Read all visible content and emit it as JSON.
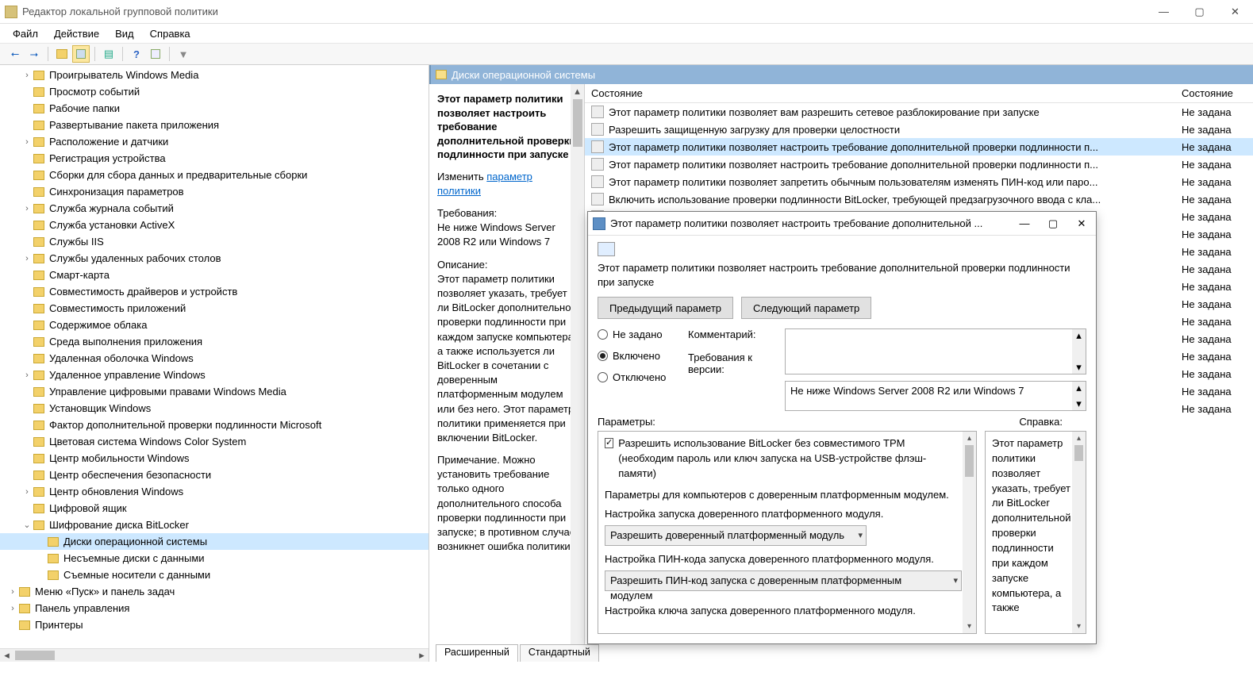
{
  "window": {
    "title": "Редактор локальной групповой политики"
  },
  "menu": {
    "file": "Файл",
    "action": "Действие",
    "view": "Вид",
    "help": "Справка"
  },
  "tree": [
    {
      "label": "Проигрыватель Windows Media",
      "exp": ">",
      "lvl": 1
    },
    {
      "label": "Просмотр событий",
      "exp": "",
      "lvl": 1
    },
    {
      "label": "Рабочие папки",
      "exp": "",
      "lvl": 1
    },
    {
      "label": "Развертывание пакета приложения",
      "exp": "",
      "lvl": 1
    },
    {
      "label": "Расположение и датчики",
      "exp": ">",
      "lvl": 1
    },
    {
      "label": "Регистрация устройства",
      "exp": "",
      "lvl": 1
    },
    {
      "label": "Сборки для сбора данных и предварительные сборки",
      "exp": "",
      "lvl": 1
    },
    {
      "label": "Синхронизация параметров",
      "exp": "",
      "lvl": 1
    },
    {
      "label": "Служба журнала событий",
      "exp": ">",
      "lvl": 1
    },
    {
      "label": "Служба установки ActiveX",
      "exp": "",
      "lvl": 1
    },
    {
      "label": "Службы IIS",
      "exp": "",
      "lvl": 1
    },
    {
      "label": "Службы удаленных рабочих столов",
      "exp": ">",
      "lvl": 1
    },
    {
      "label": "Смарт-карта",
      "exp": "",
      "lvl": 1
    },
    {
      "label": "Совместимость драйверов и устройств",
      "exp": "",
      "lvl": 1
    },
    {
      "label": "Совместимость приложений",
      "exp": "",
      "lvl": 1
    },
    {
      "label": "Содержимое облака",
      "exp": "",
      "lvl": 1
    },
    {
      "label": "Среда выполнения приложения",
      "exp": "",
      "lvl": 1
    },
    {
      "label": "Удаленная оболочка Windows",
      "exp": "",
      "lvl": 1
    },
    {
      "label": "Удаленное управление Windows",
      "exp": ">",
      "lvl": 1
    },
    {
      "label": "Управление цифровыми правами Windows Media",
      "exp": "",
      "lvl": 1
    },
    {
      "label": "Установщик Windows",
      "exp": "",
      "lvl": 1
    },
    {
      "label": "Фактор дополнительной проверки подлинности Microsoft",
      "exp": "",
      "lvl": 1
    },
    {
      "label": "Цветовая система Windows Color System",
      "exp": "",
      "lvl": 1
    },
    {
      "label": "Центр мобильности Windows",
      "exp": "",
      "lvl": 1
    },
    {
      "label": "Центр обеспечения безопасности",
      "exp": "",
      "lvl": 1
    },
    {
      "label": "Центр обновления Windows",
      "exp": ">",
      "lvl": 1
    },
    {
      "label": "Цифровой ящик",
      "exp": "",
      "lvl": 1
    },
    {
      "label": "Шифрование диска BitLocker",
      "exp": "v",
      "lvl": 1
    },
    {
      "label": "Диски операционной системы",
      "exp": "",
      "lvl": 2,
      "selected": true
    },
    {
      "label": "Несъемные диски с данными",
      "exp": "",
      "lvl": 2
    },
    {
      "label": "Съемные носители с данными",
      "exp": "",
      "lvl": 2
    },
    {
      "label": "Меню «Пуск» и панель задач",
      "exp": ">",
      "lvl": 0
    },
    {
      "label": "Панель управления",
      "exp": ">",
      "lvl": 0
    },
    {
      "label": "Принтеры",
      "exp": "",
      "lvl": 0
    }
  ],
  "right_header": "Диски операционной системы",
  "desc": {
    "title": "Этот параметр политики позволяет настроить требование дополнительной проверки подлинности при запуске",
    "edit_label": "Изменить",
    "edit_link": "параметр политики",
    "req_label": "Требования:",
    "req_text": "Не ниже Windows Server 2008 R2 или Windows 7",
    "desc_label": "Описание:",
    "desc_text": "Этот параметр политики позволяет указать, требует ли BitLocker дополнительной проверки подлинности при каждом запуске компьютера, а также используется ли BitLocker в сочетании с доверенным платформенным модулем или без него. Этот параметр политики применяется при включении BitLocker.",
    "note": "Примечание. Можно установить требование только одного дополнительного способа проверки подлинности при запуске; в противном случае возникнет ошибка политики."
  },
  "list_head": {
    "col1": "Состояние",
    "col2": "Состояние"
  },
  "list": [
    {
      "label": "Этот параметр политики позволяет вам разрешить сетевое разблокирование при запуске",
      "state": "Не задана"
    },
    {
      "label": "Разрешить защищенную загрузку для проверки целостности",
      "state": "Не задана"
    },
    {
      "label": "Этот параметр политики позволяет настроить требование дополнительной проверки подлинности п...",
      "state": "Не задана",
      "selected": true
    },
    {
      "label": "Этот параметр политики позволяет настроить требование дополнительной проверки подлинности п...",
      "state": "Не задана"
    },
    {
      "label": "Этот параметр политики позволяет запретить обычным пользователям изменять ПИН-код или паро...",
      "state": "Не задана"
    },
    {
      "label": "Включить использование проверки подлинности BitLocker, требующей предзагрузочного ввода с кла...",
      "state": "Не задана"
    },
    {
      "label": "",
      "state": "Не задана"
    },
    {
      "label": "",
      "state": "Не задана"
    },
    {
      "label": "... ",
      "state": "Не задана"
    },
    {
      "label": "",
      "state": "Не задана"
    },
    {
      "label": "",
      "state": "Не задана"
    },
    {
      "label": "",
      "state": "Не задана"
    },
    {
      "label": "",
      "state": "Не задана"
    },
    {
      "label": "",
      "state": "Не задана"
    },
    {
      "label": "",
      "state": "Не задана"
    },
    {
      "label": "",
      "state": "Не задана"
    },
    {
      "label": "",
      "state": "Не задана"
    },
    {
      "label": "",
      "state": "Не задана"
    }
  ],
  "tabs": {
    "ext": "Расширенный",
    "std": "Стандартный"
  },
  "dialog": {
    "title": "Этот параметр политики позволяет настроить требование дополнительной ...",
    "setting_name": "Этот параметр политики позволяет настроить требование дополнительной проверки подлинности при запуске",
    "prev": "Предыдущий параметр",
    "next": "Следующий параметр",
    "r_not": "Не задано",
    "r_on": "Включено",
    "r_off": "Отключено",
    "comment_label": "Комментарий:",
    "req_label": "Требования к версии:",
    "req_value": "Не ниже Windows Server 2008 R2 или Windows 7",
    "opt_head": "Параметры:",
    "help_head": "Справка:",
    "chk_tpm": "Разрешить использование BitLocker без совместимого TPM (необходим пароль или ключ запуска на USB-устройстве флэш-памяти)",
    "line_tpm_pc": "Параметры для компьютеров с доверенным платформенным модулем.",
    "line_tpm_start": "Настройка запуска доверенного платформенного модуля.",
    "sel_tpm": "Разрешить доверенный платформенный модуль",
    "line_pin": "Настройка ПИН-кода запуска доверенного платформенного модуля.",
    "sel_pin": "Разрешить ПИН-код запуска с доверенным платформенным модулем",
    "line_key": "Настройка ключа запуска доверенного платформенного модуля.",
    "help_text": "Этот параметр политики позволяет указать, требует ли BitLocker дополнительной проверки подлинности при каждом запуске компьютера, а также"
  }
}
